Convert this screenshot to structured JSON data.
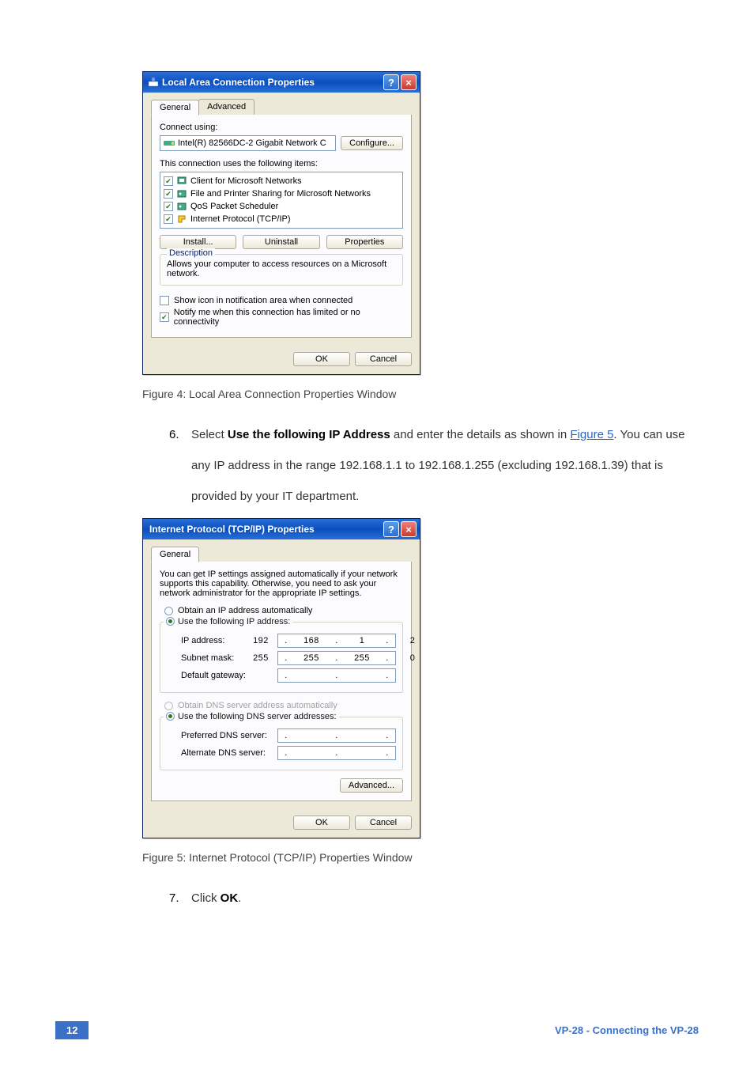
{
  "dialog1": {
    "title": "Local Area Connection Properties",
    "tabs": {
      "general": "General",
      "advanced": "Advanced"
    },
    "connect_using": "Connect using:",
    "adapter": "Intel(R) 82566DC-2 Gigabit Network C",
    "configure_btn": "Configure...",
    "items_label": "This connection uses the following items:",
    "items": [
      "Client for Microsoft Networks",
      "File and Printer Sharing for Microsoft Networks",
      "QoS Packet Scheduler",
      "Internet Protocol (TCP/IP)"
    ],
    "install_btn": "Install...",
    "uninstall_btn": "Uninstall",
    "properties_btn": "Properties",
    "desc_title": "Description",
    "desc_text": "Allows your computer to access resources on a Microsoft network.",
    "show_icon": "Show icon in notification area when connected",
    "notify": "Notify me when this connection has limited or no connectivity",
    "ok": "OK",
    "cancel": "Cancel"
  },
  "caption1": "Figure 4: Local Area Connection Properties Window",
  "step6": {
    "num": "6.",
    "pre": "Select ",
    "bold": "Use the following IP Address",
    "post1": " and enter the details as shown in ",
    "link": "Figure 5",
    "post2": ". You can use any IP address in the range 192.168.1.1 to 192.168.1.255 (excluding 192.168.1.39) that is provided by your IT department."
  },
  "dialog2": {
    "title": "Internet Protocol (TCP/IP) Properties",
    "tab_general": "General",
    "intro": "You can get IP settings assigned automatically if your network supports this capability. Otherwise, you need to ask your network administrator for the appropriate IP settings.",
    "obtain_ip": "Obtain an IP address automatically",
    "use_ip": "Use the following IP address:",
    "ip_label": "IP address:",
    "ip_value": [
      "192",
      "168",
      "1",
      "2"
    ],
    "subnet_label": "Subnet mask:",
    "subnet_value": [
      "255",
      "255",
      "255",
      "0"
    ],
    "gateway_label": "Default gateway:",
    "obtain_dns": "Obtain DNS server address automatically",
    "use_dns": "Use the following DNS server addresses:",
    "pref_dns": "Preferred DNS server:",
    "alt_dns": "Alternate DNS server:",
    "advanced_btn": "Advanced...",
    "ok": "OK",
    "cancel": "Cancel"
  },
  "caption2": "Figure 5: Internet Protocol (TCP/IP) Properties Window",
  "step7": {
    "num": "7.",
    "pre": "Click ",
    "bold": "OK",
    "post": "."
  },
  "footer": {
    "page": "12",
    "section": "VP-28 - Connecting the VP-28"
  }
}
